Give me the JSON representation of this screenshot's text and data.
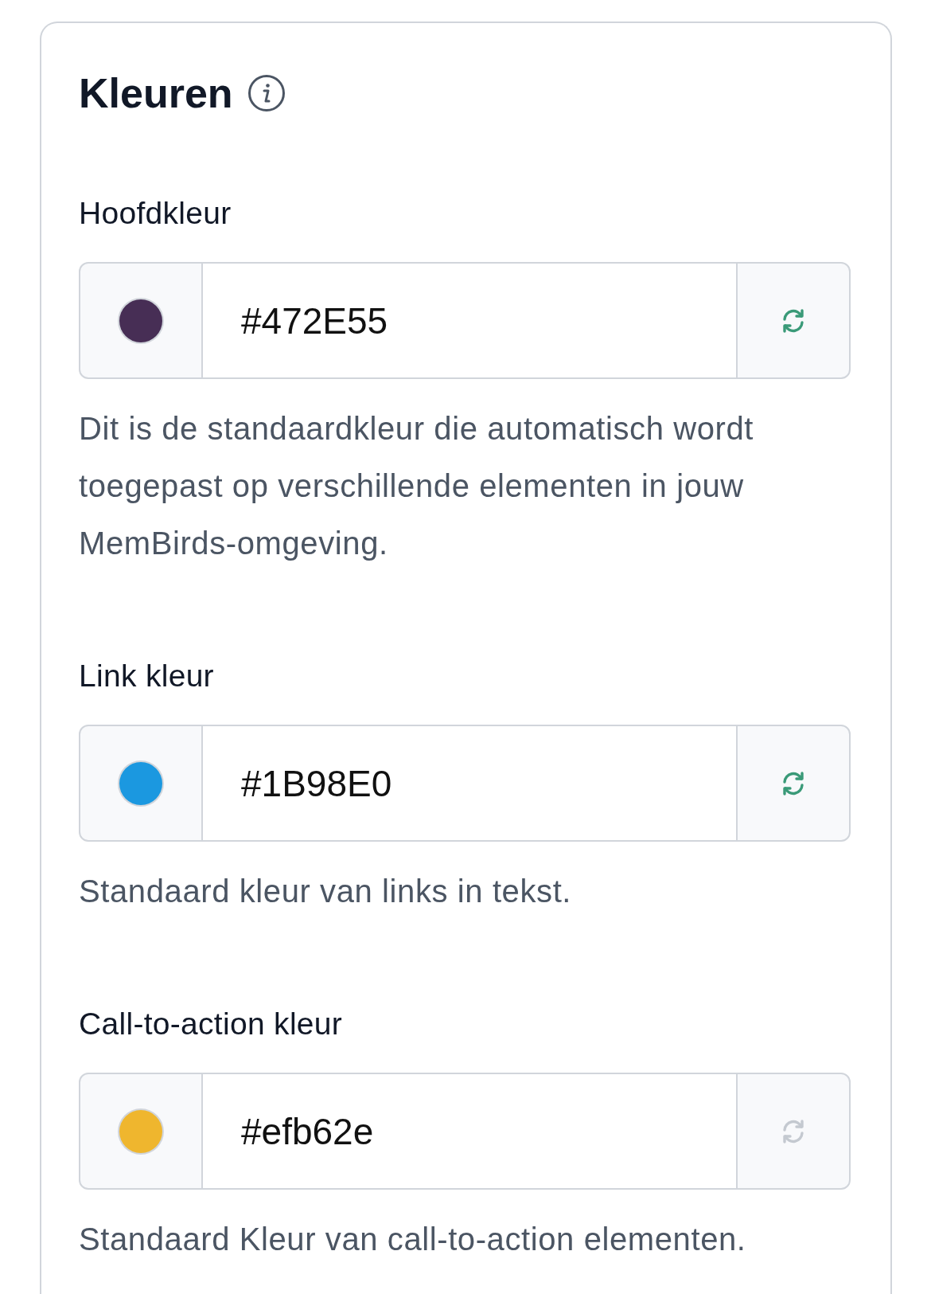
{
  "title": "Kleuren",
  "fields": [
    {
      "label": "Hoofdkleur",
      "value": "#472E55",
      "color": "#472e55",
      "reset_disabled": false,
      "description": "Dit is de standaardkleur die automatisch wordt toegepast op verschillende elementen in jouw MemBirds-omgeving."
    },
    {
      "label": "Link kleur",
      "value": "#1B98E0",
      "color": "#1b98e0",
      "reset_disabled": false,
      "description": "Standaard kleur van links in tekst."
    },
    {
      "label": "Call-to-action kleur",
      "value": "#efb62e",
      "color": "#efb62e",
      "reset_disabled": true,
      "description": "Standaard Kleur van call-to-action elementen."
    }
  ]
}
